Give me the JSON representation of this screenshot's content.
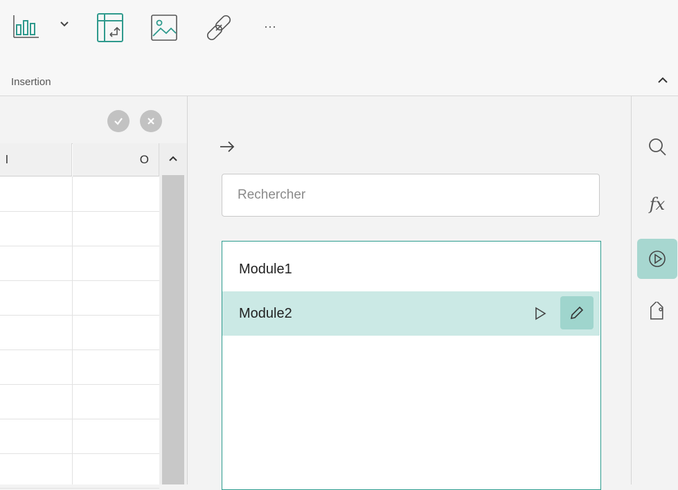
{
  "ribbon": {
    "icons": [
      "bar-chart-icon",
      "chevron-down-icon",
      "pivot-table-icon",
      "image-icon",
      "link-icon",
      "more-icon"
    ],
    "more_label": "···",
    "group_label": "Insertion"
  },
  "sheet": {
    "column_headers": [
      "l",
      "O"
    ]
  },
  "macros_panel": {
    "search_placeholder": "Rechercher",
    "search_value": "",
    "modules": [
      {
        "name": "Module1",
        "selected": false
      },
      {
        "name": "Module2",
        "selected": true
      }
    ]
  },
  "sidebar": {
    "fx_label": "fx",
    "icons": [
      "search-icon",
      "function-icon",
      "macros-icon",
      "tag-icon"
    ]
  },
  "colors": {
    "accent": "#2d9c8f",
    "selected_row": "#cbe9e5",
    "active_button": "#a7d7d0"
  }
}
